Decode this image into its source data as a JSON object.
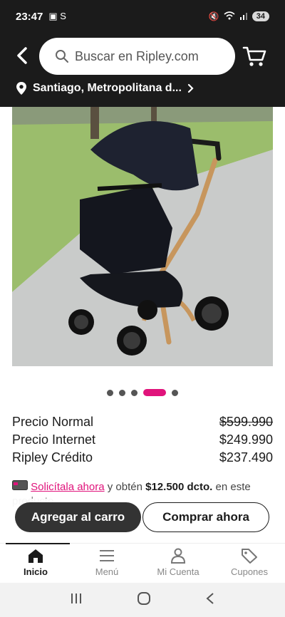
{
  "status_bar": {
    "time": "23:47",
    "notif_icons": "▣ S",
    "battery": "34"
  },
  "header": {
    "search_placeholder": "Buscar en Ripley.com",
    "location": "Santiago, Metropolitana d..."
  },
  "product": {
    "image_alt": "stroller-photo",
    "carousel": {
      "count": 5,
      "active_index": 3
    }
  },
  "prices": [
    {
      "label": "Precio Normal",
      "value": "$599.990",
      "strikethrough": true
    },
    {
      "label": "Precio Internet",
      "value": "$249.990",
      "strikethrough": false
    },
    {
      "label": "Ripley Crédito",
      "value": "$237.490",
      "strikethrough": false
    }
  ],
  "promo": {
    "link": "Solicítala ahora",
    "text_before_amount": " y obtén ",
    "amount": "$12.500 dcto.",
    "text_after": " en este",
    "line2": "producto"
  },
  "actions": {
    "add_to_cart": "Agregar al carro",
    "buy_now": "Comprar ahora"
  },
  "tabbar": {
    "tabs": [
      {
        "label": "Inicio",
        "icon": "home-icon",
        "active": true
      },
      {
        "label": "Menú",
        "icon": "menu-icon",
        "active": false
      },
      {
        "label": "Mi Cuenta",
        "icon": "user-icon",
        "active": false
      },
      {
        "label": "Cupones",
        "icon": "tag-icon",
        "active": false
      }
    ]
  },
  "colors": {
    "accent": "#e0137b",
    "header_bg": "#1b1b1b"
  }
}
